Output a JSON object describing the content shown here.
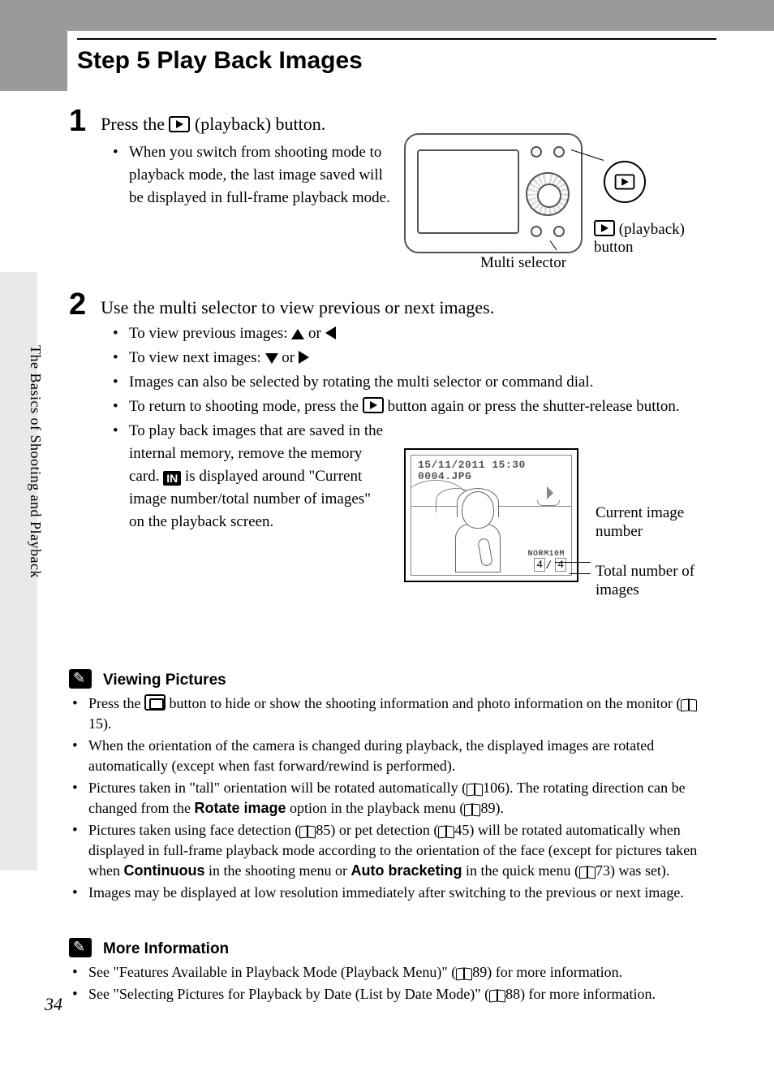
{
  "header": {
    "title": "Step 5 Play Back Images"
  },
  "sideTab": "The Basics of Shooting and Playback",
  "step1": {
    "num": "1",
    "head_pre": "Press the ",
    "head_post": " (playback) button.",
    "bullet1": "When you switch from shooting mode to playback mode, the last image saved will be displayed in full-frame playback mode."
  },
  "fig1": {
    "multiSelector": "Multi selector",
    "playbackBtn_pre": " (playback)",
    "playbackBtn_post": "button"
  },
  "step2": {
    "num": "2",
    "head": "Use the multi selector to view previous or next images.",
    "b1_pre": "To view previous images: ",
    "b1_mid": " or ",
    "b2_pre": "To view next images: ",
    "b2_mid": " or ",
    "b3": "Images can also be selected by rotating the multi selector or command dial.",
    "b4_pre": "To return to shooting mode, press the ",
    "b4_post": " button again or press the shutter-release button.",
    "b5_pre": "To play back images that are saved in the internal memory, remove the memory card. ",
    "b5_post": " is displayed around \"Current image number/total number of images\" on the playback screen."
  },
  "lcd": {
    "date": "15/11/2011 15:30",
    "file": "0004.JPG",
    "norm": "NORM10M",
    "cur": "4",
    "slash": "/",
    "tot": "4",
    "labelCurrent": "Current image number",
    "labelTotal": "Total number of images"
  },
  "viewing": {
    "title": "Viewing Pictures",
    "b1_pre": "Press the ",
    "b1_mid": " button to hide or show the shooting information and photo information on the monitor (",
    "b1_ref": "15",
    "b1_post": ").",
    "b2": "When the orientation of the camera is changed during playback, the displayed images are rotated automatically (except when fast forward/rewind is performed).",
    "b3_pre": "Pictures taken in \"tall\" orientation will be rotated automatically (",
    "b3_ref1": "106",
    "b3_mid": "). The rotating direction can be changed from the ",
    "b3_bold": "Rotate image",
    "b3_mid2": " option in the playback menu (",
    "b3_ref2": "89",
    "b3_post": ").",
    "b4_pre": "Pictures taken using face detection (",
    "b4_ref1": "85",
    "b4_mid1": ") or pet detection (",
    "b4_ref2": "45",
    "b4_mid2": ") will be rotated automatically when displayed in full-frame playback mode according to the orientation of the face (except for pictures taken when ",
    "b4_bold1": "Continuous",
    "b4_mid3": " in the shooting menu or ",
    "b4_bold2": "Auto bracketing",
    "b4_mid4": " in the quick menu (",
    "b4_ref3": "73",
    "b4_post": ") was set).",
    "b5": "Images may be displayed at low resolution immediately after switching to the previous or next image."
  },
  "more": {
    "title": "More Information",
    "b1_pre": "See \"Features Available in Playback Mode (Playback Menu)\" (",
    "b1_ref": "89",
    "b1_post": ") for more information.",
    "b2_pre": "See \"Selecting Pictures for Playback by Date (List by Date Mode)\" (",
    "b2_ref": "88",
    "b2_post": ") for more information."
  },
  "pageNumber": "34",
  "inIcon": "IN"
}
